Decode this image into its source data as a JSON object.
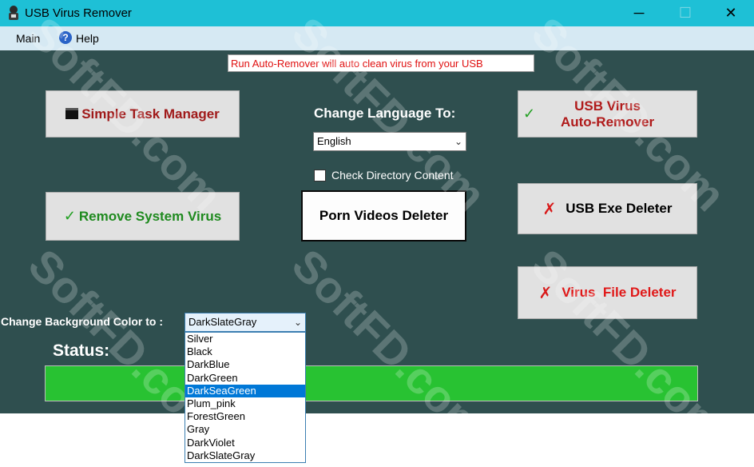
{
  "window": {
    "title": "USB Virus Remover",
    "controls": {
      "minimize": "─",
      "maximize": "☐",
      "close": "✕"
    }
  },
  "menu": {
    "main": "Main",
    "help": "Help"
  },
  "banner": "Run Auto-Remover will auto clean virus from your USB",
  "buttons": {
    "task_manager": "Simple Task Manager",
    "remove_system_virus": "Remove System Virus",
    "porn_deleter": "Porn Videos Deleter",
    "auto_remover_line1": "USB Virus",
    "auto_remover_line2": "Auto-Remover",
    "exe_deleter": "USB Exe Deleter",
    "file_deleter": "Virus  File Deleter"
  },
  "language": {
    "label": "Change Language To:",
    "selected": "English",
    "checkbox_label": "Check Directory Content"
  },
  "background_color": {
    "label": "Change Background Color to :",
    "selected": "DarkSlateGray",
    "options": [
      "Silver",
      "Black",
      "DarkBlue",
      "DarkGreen",
      "DarkSeaGreen",
      "Plum_pink",
      "ForestGreen",
      "Gray",
      "DarkViolet",
      "DarkSlateGray"
    ],
    "highlighted": "DarkSeaGreen"
  },
  "status": {
    "label": "Status:",
    "progress": 1.0
  },
  "watermark": "SoftFD.com",
  "colors": {
    "titlebar": "#1ec0d6",
    "background": "#2f4f4f",
    "progress": "#28c232"
  },
  "icons": {
    "app": "usb-spy-icon",
    "help": "help-icon",
    "task": "terminal-icon",
    "ok": "check-icon",
    "x": "x-icon",
    "dropdown": "chevron-down-icon"
  }
}
